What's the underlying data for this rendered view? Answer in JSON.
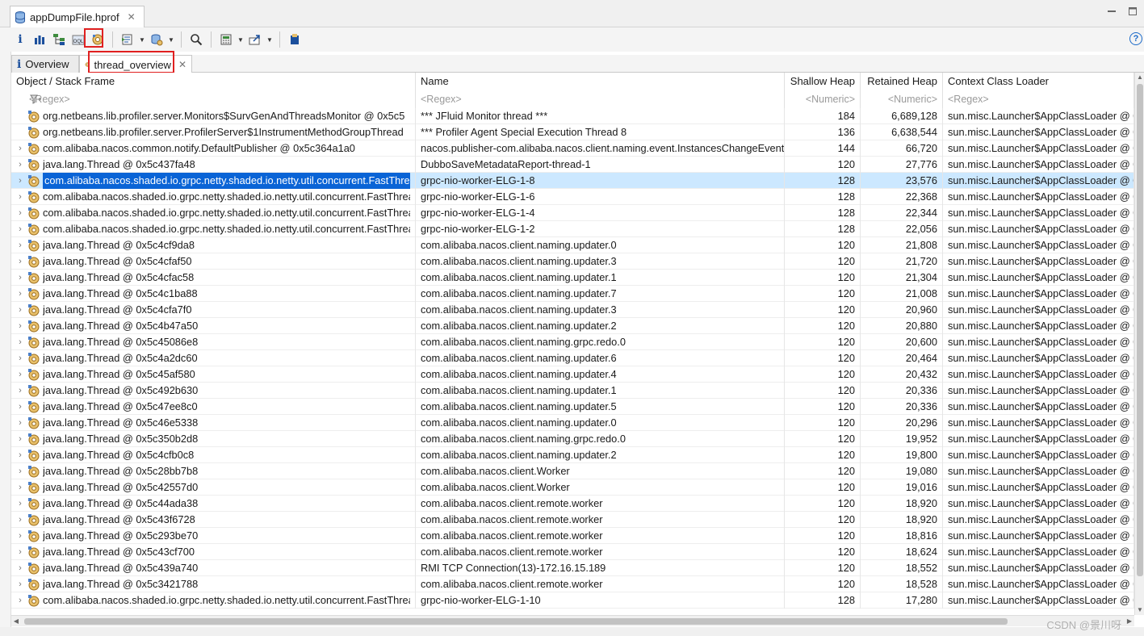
{
  "editor_tab": {
    "title": "appDumpFile.hprof"
  },
  "inner_tabs": [
    {
      "label": "Overview"
    },
    {
      "label": "thread_overview"
    }
  ],
  "columns": {
    "object": "Object / Stack Frame",
    "name": "Name",
    "shallow": "Shallow Heap",
    "retained": "Retained Heap",
    "loader": "Context Class Loader"
  },
  "filters": {
    "object": "<Regex>",
    "name": "<Regex>",
    "shallow": "<Numeric>",
    "retained": "<Numeric>",
    "loader": "<Regex>"
  },
  "rows": [
    {
      "object": "org.netbeans.lib.profiler.server.Monitors$SurvGenAndThreadsMonitor @ 0x5c5",
      "name": "*** JFluid Monitor thread ***",
      "shallow": "184",
      "retained": "6,689,128",
      "loader": "sun.misc.Launcher$AppClassLoader @ 0"
    },
    {
      "object": "org.netbeans.lib.profiler.server.ProfilerServer$1InstrumentMethodGroupThread",
      "name": "*** Profiler Agent Special Execution Thread 8",
      "shallow": "136",
      "retained": "6,638,544",
      "loader": "sun.misc.Launcher$AppClassLoader @ 0"
    },
    {
      "object": "com.alibaba.nacos.common.notify.DefaultPublisher @ 0x5c364a1a0",
      "name": "nacos.publisher-com.alibaba.nacos.client.naming.event.InstancesChangeEvent",
      "shallow": "144",
      "retained": "66,720",
      "loader": "sun.misc.Launcher$AppClassLoader @ 0"
    },
    {
      "object": "java.lang.Thread @ 0x5c437fa48",
      "name": "DubboSaveMetadataReport-thread-1",
      "shallow": "120",
      "retained": "27,776",
      "loader": "sun.misc.Launcher$AppClassLoader @ 0"
    },
    {
      "object": "com.alibaba.nacos.shaded.io.grpc.netty.shaded.io.netty.util.concurrent.FastThrea",
      "name": "grpc-nio-worker-ELG-1-8",
      "shallow": "128",
      "retained": "23,576",
      "loader": "sun.misc.Launcher$AppClassLoader @ 0"
    },
    {
      "object": "com.alibaba.nacos.shaded.io.grpc.netty.shaded.io.netty.util.concurrent.FastThrea",
      "name": "grpc-nio-worker-ELG-1-6",
      "shallow": "128",
      "retained": "22,368",
      "loader": "sun.misc.Launcher$AppClassLoader @ 0"
    },
    {
      "object": "com.alibaba.nacos.shaded.io.grpc.netty.shaded.io.netty.util.concurrent.FastThrea",
      "name": "grpc-nio-worker-ELG-1-4",
      "shallow": "128",
      "retained": "22,344",
      "loader": "sun.misc.Launcher$AppClassLoader @ 0"
    },
    {
      "object": "com.alibaba.nacos.shaded.io.grpc.netty.shaded.io.netty.util.concurrent.FastThrea",
      "name": "grpc-nio-worker-ELG-1-2",
      "shallow": "128",
      "retained": "22,056",
      "loader": "sun.misc.Launcher$AppClassLoader @ 0"
    },
    {
      "object": "java.lang.Thread @ 0x5c4cf9da8",
      "name": "com.alibaba.nacos.client.naming.updater.0",
      "shallow": "120",
      "retained": "21,808",
      "loader": "sun.misc.Launcher$AppClassLoader @ 0"
    },
    {
      "object": "java.lang.Thread @ 0x5c4cfaf50",
      "name": "com.alibaba.nacos.client.naming.updater.3",
      "shallow": "120",
      "retained": "21,720",
      "loader": "sun.misc.Launcher$AppClassLoader @ 0"
    },
    {
      "object": "java.lang.Thread @ 0x5c4cfac58",
      "name": "com.alibaba.nacos.client.naming.updater.1",
      "shallow": "120",
      "retained": "21,304",
      "loader": "sun.misc.Launcher$AppClassLoader @ 0"
    },
    {
      "object": "java.lang.Thread @ 0x5c4c1ba88",
      "name": "com.alibaba.nacos.client.naming.updater.7",
      "shallow": "120",
      "retained": "21,008",
      "loader": "sun.misc.Launcher$AppClassLoader @ 0"
    },
    {
      "object": "java.lang.Thread @ 0x5c4cfa7f0",
      "name": "com.alibaba.nacos.client.naming.updater.3",
      "shallow": "120",
      "retained": "20,960",
      "loader": "sun.misc.Launcher$AppClassLoader @ 0"
    },
    {
      "object": "java.lang.Thread @ 0x5c4b47a50",
      "name": "com.alibaba.nacos.client.naming.updater.2",
      "shallow": "120",
      "retained": "20,880",
      "loader": "sun.misc.Launcher$AppClassLoader @ 0"
    },
    {
      "object": "java.lang.Thread @ 0x5c45086e8",
      "name": "com.alibaba.nacos.client.naming.grpc.redo.0",
      "shallow": "120",
      "retained": "20,600",
      "loader": "sun.misc.Launcher$AppClassLoader @ 0"
    },
    {
      "object": "java.lang.Thread @ 0x5c4a2dc60",
      "name": "com.alibaba.nacos.client.naming.updater.6",
      "shallow": "120",
      "retained": "20,464",
      "loader": "sun.misc.Launcher$AppClassLoader @ 0"
    },
    {
      "object": "java.lang.Thread @ 0x5c45af580",
      "name": "com.alibaba.nacos.client.naming.updater.4",
      "shallow": "120",
      "retained": "20,432",
      "loader": "sun.misc.Launcher$AppClassLoader @ 0"
    },
    {
      "object": "java.lang.Thread @ 0x5c492b630",
      "name": "com.alibaba.nacos.client.naming.updater.1",
      "shallow": "120",
      "retained": "20,336",
      "loader": "sun.misc.Launcher$AppClassLoader @ 0"
    },
    {
      "object": "java.lang.Thread @ 0x5c47ee8c0",
      "name": "com.alibaba.nacos.client.naming.updater.5",
      "shallow": "120",
      "retained": "20,336",
      "loader": "sun.misc.Launcher$AppClassLoader @ 0"
    },
    {
      "object": "java.lang.Thread @ 0x5c46e5338",
      "name": "com.alibaba.nacos.client.naming.updater.0",
      "shallow": "120",
      "retained": "20,296",
      "loader": "sun.misc.Launcher$AppClassLoader @ 0"
    },
    {
      "object": "java.lang.Thread @ 0x5c350b2d8",
      "name": "com.alibaba.nacos.client.naming.grpc.redo.0",
      "shallow": "120",
      "retained": "19,952",
      "loader": "sun.misc.Launcher$AppClassLoader @ 0"
    },
    {
      "object": "java.lang.Thread @ 0x5c4cfb0c8",
      "name": "com.alibaba.nacos.client.naming.updater.2",
      "shallow": "120",
      "retained": "19,800",
      "loader": "sun.misc.Launcher$AppClassLoader @ 0"
    },
    {
      "object": "java.lang.Thread @ 0x5c28bb7b8",
      "name": "com.alibaba.nacos.client.Worker",
      "shallow": "120",
      "retained": "19,080",
      "loader": "sun.misc.Launcher$AppClassLoader @ 0"
    },
    {
      "object": "java.lang.Thread @ 0x5c42557d0",
      "name": "com.alibaba.nacos.client.Worker",
      "shallow": "120",
      "retained": "19,016",
      "loader": "sun.misc.Launcher$AppClassLoader @ 0"
    },
    {
      "object": "java.lang.Thread @ 0x5c44ada38",
      "name": "com.alibaba.nacos.client.remote.worker",
      "shallow": "120",
      "retained": "18,920",
      "loader": "sun.misc.Launcher$AppClassLoader @ 0"
    },
    {
      "object": "java.lang.Thread @ 0x5c43f6728",
      "name": "com.alibaba.nacos.client.remote.worker",
      "shallow": "120",
      "retained": "18,920",
      "loader": "sun.misc.Launcher$AppClassLoader @ 0"
    },
    {
      "object": "java.lang.Thread @ 0x5c293be70",
      "name": "com.alibaba.nacos.client.remote.worker",
      "shallow": "120",
      "retained": "18,816",
      "loader": "sun.misc.Launcher$AppClassLoader @ 0"
    },
    {
      "object": "java.lang.Thread @ 0x5c43cf700",
      "name": "com.alibaba.nacos.client.remote.worker",
      "shallow": "120",
      "retained": "18,624",
      "loader": "sun.misc.Launcher$AppClassLoader @ 0"
    },
    {
      "object": "java.lang.Thread @ 0x5c439a740",
      "name": "RMI TCP Connection(13)-172.16.15.189",
      "shallow": "120",
      "retained": "18,552",
      "loader": "sun.misc.Launcher$AppClassLoader @ 0"
    },
    {
      "object": "java.lang.Thread @ 0x5c3421788",
      "name": "com.alibaba.nacos.client.remote.worker",
      "shallow": "120",
      "retained": "18,528",
      "loader": "sun.misc.Launcher$AppClassLoader @ 0"
    },
    {
      "object": "com.alibaba.nacos.shaded.io.grpc.netty.shaded.io.netty.util.concurrent.FastThrea",
      "name": "grpc-nio-worker-ELG-1-10",
      "shallow": "128",
      "retained": "17,280",
      "loader": "sun.misc.Launcher$AppClassLoader @ 0"
    }
  ],
  "selected_row": 4,
  "non_expandable_rows": [
    0,
    1
  ],
  "watermark": "CSDN @景川呀",
  "colors": {
    "selection": "#0a64d6",
    "row_highlight": "#cce8ff",
    "annotation_red": "#e02020"
  }
}
